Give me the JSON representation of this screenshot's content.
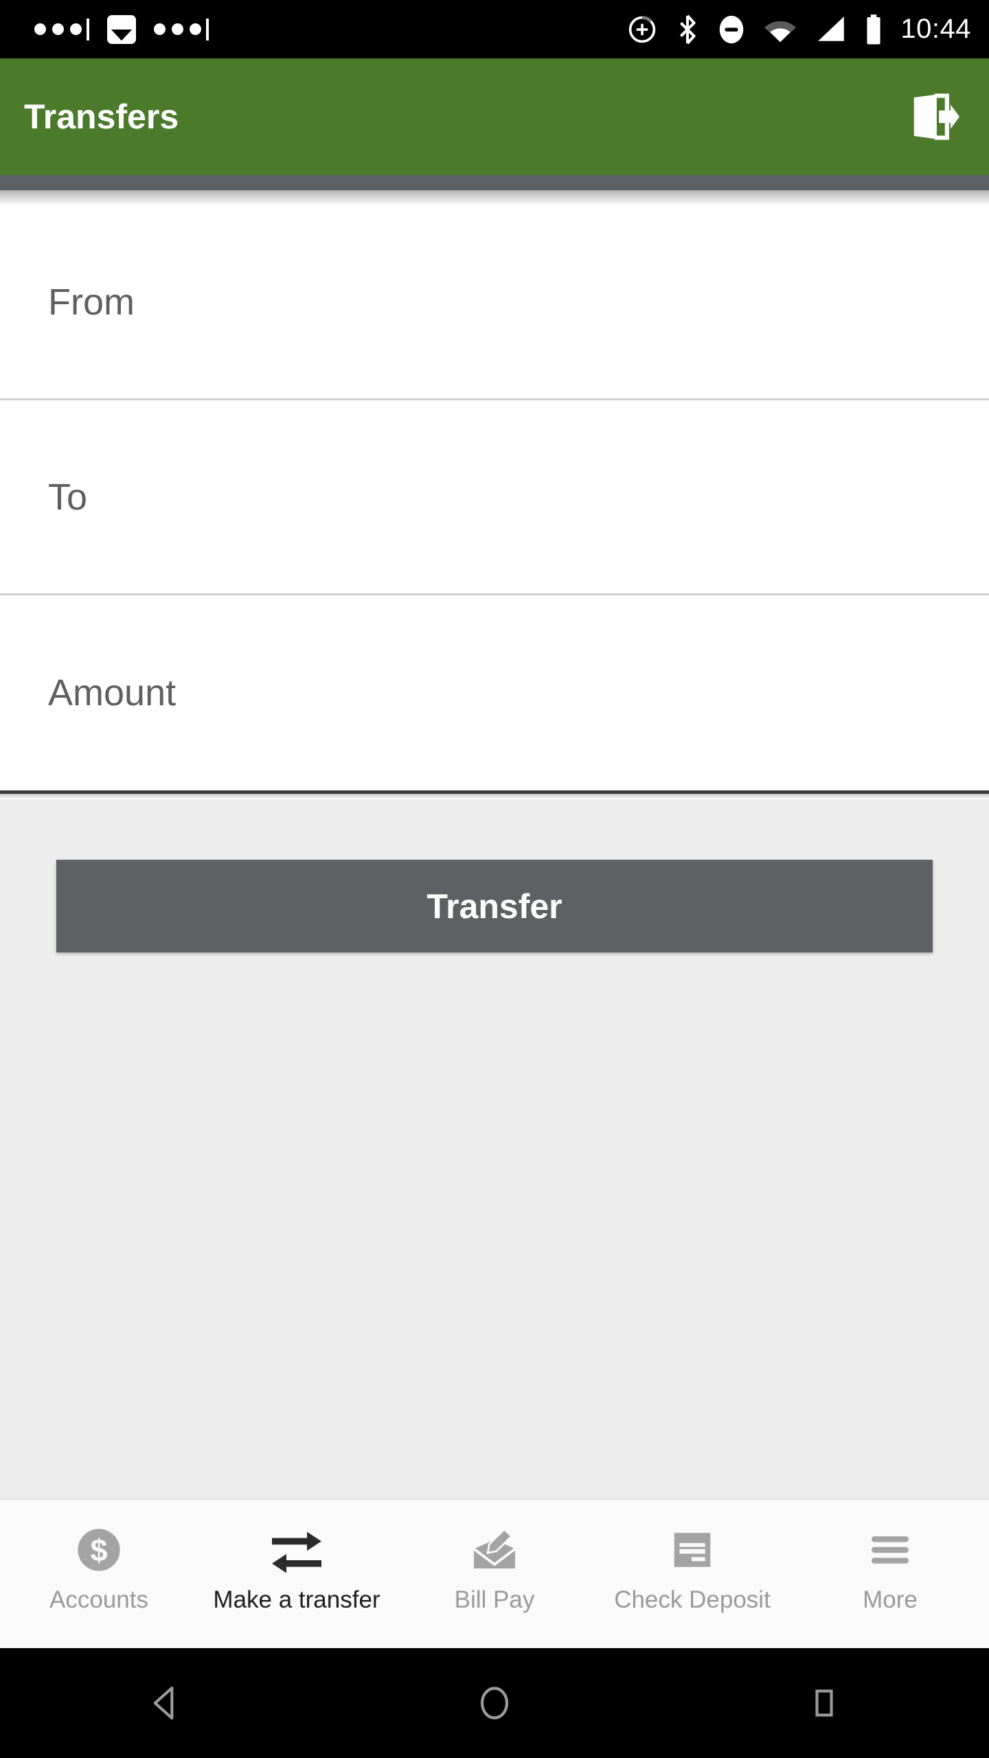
{
  "status_bar": {
    "time": "10:44",
    "background": "#000000",
    "left_icons": [
      "notification-dots-icon",
      "image-icon",
      "notification-dots-icon"
    ],
    "right_icons": [
      "location-add-icon",
      "bluetooth-icon",
      "do-not-disturb-icon",
      "wifi-icon",
      "cellular-signal-icon",
      "battery-icon"
    ]
  },
  "app_bar": {
    "title": "Transfers",
    "background": "#4b7a2a",
    "title_color": "#ffffff",
    "action_icon": "logout-icon",
    "underline_color": "#5c6166"
  },
  "form": {
    "background": "#ffffff",
    "divider_color": "#d0d0d0",
    "label_color": "#5f5f5f",
    "fields": [
      {
        "name": "from",
        "label": "From",
        "value": "",
        "placeholder": "From"
      },
      {
        "name": "to",
        "label": "To",
        "value": "",
        "placeholder": "To"
      },
      {
        "name": "amount",
        "label": "Amount",
        "value": "",
        "placeholder": "Amount"
      }
    ]
  },
  "content": {
    "background": "#ededed",
    "transfer_button": {
      "label": "Transfer",
      "background": "#5e6063",
      "text_color": "#ffffff"
    }
  },
  "bottom_nav": {
    "background": "#fafafa",
    "active_color": "#1e1e1e",
    "inactive_color": "#9a9a9a",
    "items": [
      {
        "label": "Accounts",
        "icon": "dollar-circle-icon",
        "active": false
      },
      {
        "label": "Make a transfer",
        "icon": "swap-arrows-icon",
        "active": true
      },
      {
        "label": "Bill Pay",
        "icon": "envelope-pen-icon",
        "active": false
      },
      {
        "label": "Check Deposit",
        "icon": "check-document-icon",
        "active": false
      },
      {
        "label": "More",
        "icon": "hamburger-menu-icon",
        "active": false
      }
    ]
  },
  "system_nav": {
    "background": "#000000",
    "buttons": [
      {
        "name": "back",
        "icon": "back-triangle-icon"
      },
      {
        "name": "home",
        "icon": "home-circle-icon"
      },
      {
        "name": "recents",
        "icon": "recents-square-icon"
      }
    ]
  }
}
